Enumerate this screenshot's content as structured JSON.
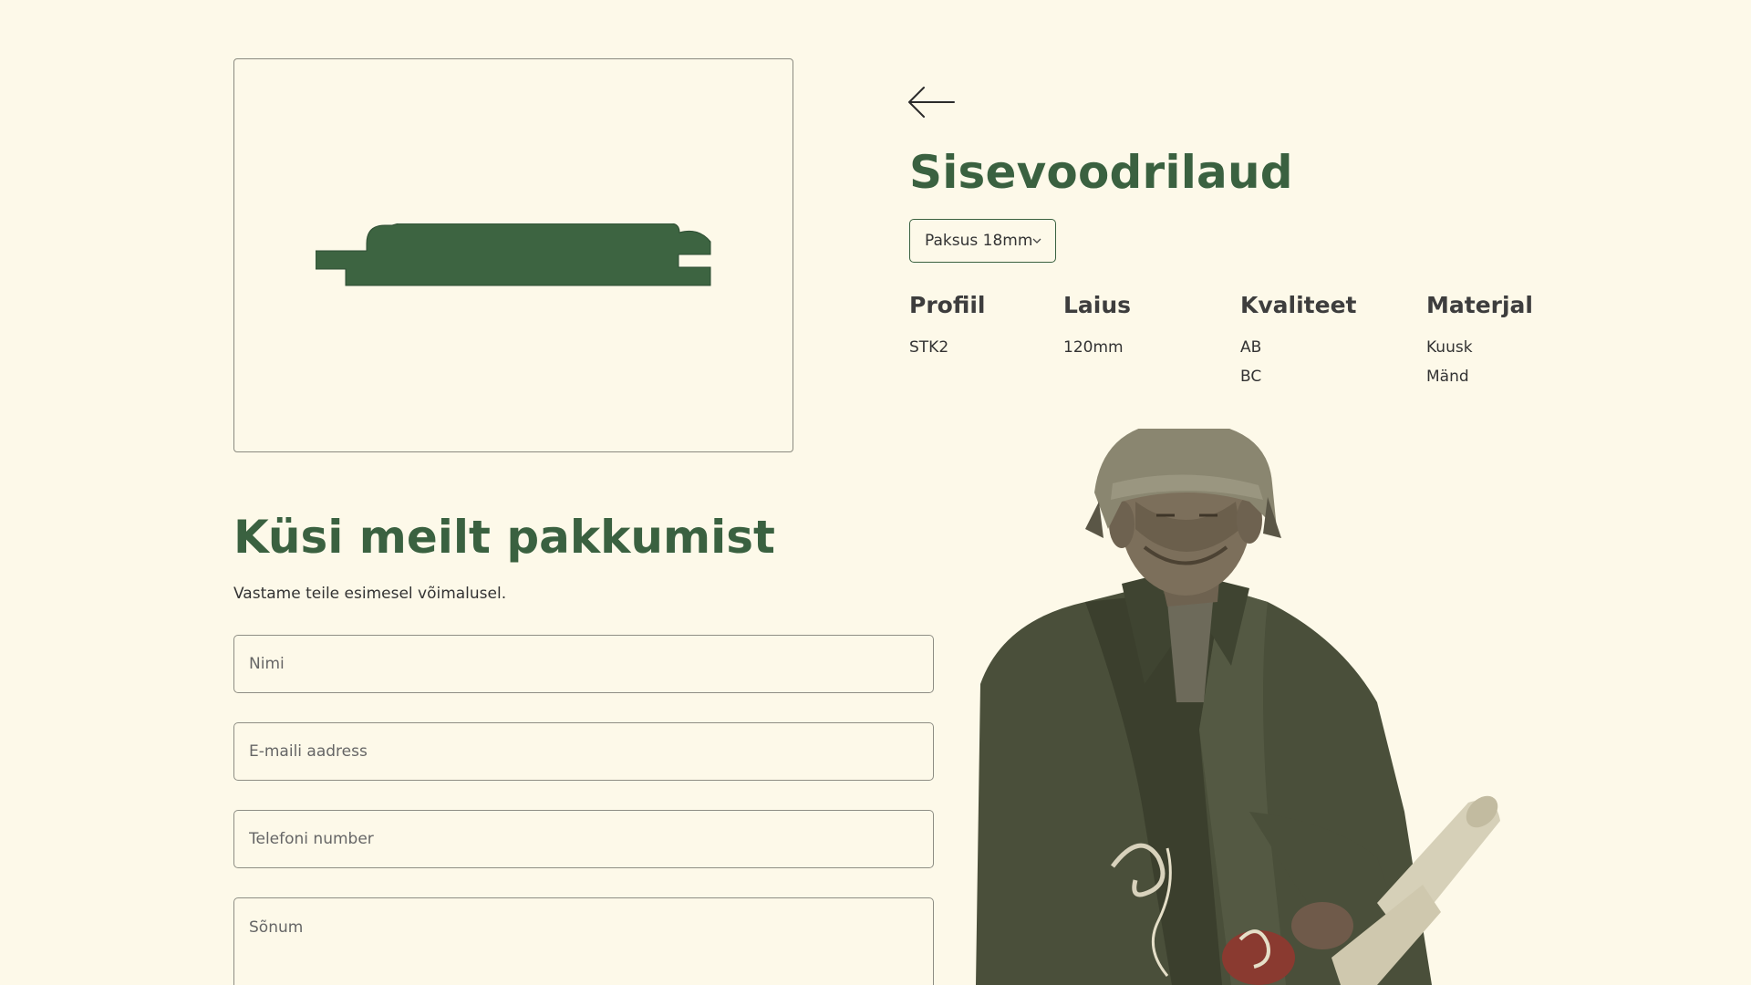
{
  "product": {
    "title": "Sisevoodrilaud",
    "thickness_select": "Paksus 18mm",
    "profile_color": "#3d6441",
    "accent_color": "#3a6140",
    "background_color": "#fdf9e9"
  },
  "icons": {
    "back": "arrow-left-icon",
    "dropdown": "chevron-down-icon"
  },
  "specs": [
    {
      "heading": "Profiil",
      "values": [
        "STK2"
      ]
    },
    {
      "heading": "Laius",
      "values": [
        "120mm"
      ]
    },
    {
      "heading": "Kvaliteet",
      "values": [
        "AB",
        "BC"
      ]
    },
    {
      "heading": "Materjal",
      "values": [
        "Kuusk",
        "Mänd"
      ]
    }
  ],
  "quote": {
    "title": "Küsi meilt pakkumist",
    "subtitle": "Vastame teile esimesel võimalusel.",
    "fields": {
      "name_placeholder": "Nimi",
      "email_placeholder": "E-maili aadress",
      "phone_placeholder": "Telefoni number",
      "message_placeholder": "Sõnum"
    }
  }
}
